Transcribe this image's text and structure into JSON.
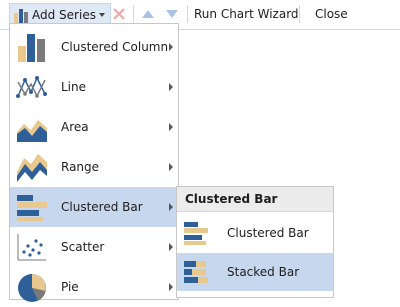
{
  "toolbar": {
    "add_series_label": "Add Series",
    "run_wizard_label": "Run Chart Wizard",
    "close_label": "Close"
  },
  "menu": {
    "items": [
      {
        "label": "Clustered Column",
        "icon": "clustered-column-icon"
      },
      {
        "label": "Line",
        "icon": "line-chart-icon"
      },
      {
        "label": "Area",
        "icon": "area-chart-icon"
      },
      {
        "label": "Range",
        "icon": "range-chart-icon"
      },
      {
        "label": "Clustered Bar",
        "icon": "clustered-bar-icon",
        "selected": true
      },
      {
        "label": "Scatter",
        "icon": "scatter-chart-icon"
      },
      {
        "label": "Pie",
        "icon": "pie-chart-icon"
      }
    ]
  },
  "submenu": {
    "header": "Clustered Bar",
    "items": [
      {
        "label": "Clustered Bar",
        "icon": "clustered-bar-icon"
      },
      {
        "label": "Stacked Bar",
        "icon": "stacked-bar-icon",
        "selected": true
      }
    ]
  },
  "colors": {
    "accent_blue": "#2e5f98",
    "accent_tan": "#e9c88e",
    "gray": "#7a7a7a",
    "highlight": "#c6d7ee"
  }
}
